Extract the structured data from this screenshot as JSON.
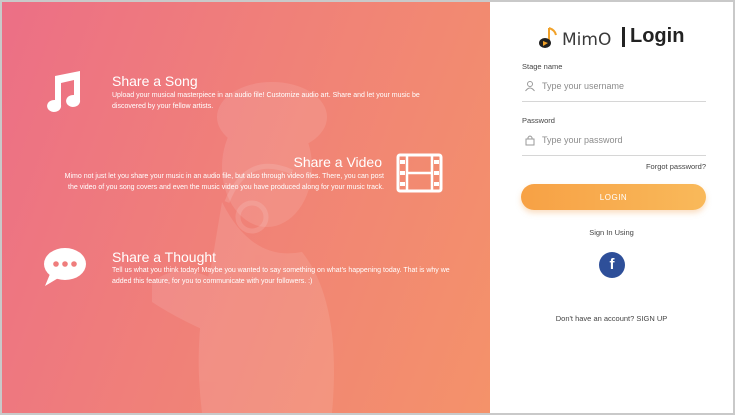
{
  "features": [
    {
      "title": "Share a Song",
      "description": "Upload your musical masterpiece in an audio file! Customize audio art. Share and let your music be discovered by your fellow artists.",
      "icon": "music-note-icon"
    },
    {
      "title": "Share a Video",
      "description": "Mimo not just let you share your music in an audio file, but also through video files. There, you can post the video of you song covers and even the music video you have produced along for your music track.",
      "icon": "film-strip-icon"
    },
    {
      "title": "Share a Thought",
      "description": "Tell us what you think today! Maybe you wanted to say something on what's happening today. That is why we added this feature, for you to communicate with your followers. :)",
      "icon": "chat-bubble-icon"
    }
  ],
  "login": {
    "brand_name": "MimO",
    "title": "Login",
    "stage_name_label": "Stage name",
    "username_placeholder": "Type your username",
    "password_label": "Password",
    "password_placeholder": "Type your password",
    "forgot_password": "Forgot password?",
    "login_button": "LOGIN",
    "sign_in_using": "Sign In Using",
    "facebook_icon": "facebook-icon",
    "no_account_text": "Don't have an account?",
    "signup_link": "SIGN UP"
  },
  "colors": {
    "gradient_start": "#ec6f86",
    "gradient_end": "#f4926a",
    "login_button": "#f7a145",
    "facebook": "#2e4f99"
  }
}
